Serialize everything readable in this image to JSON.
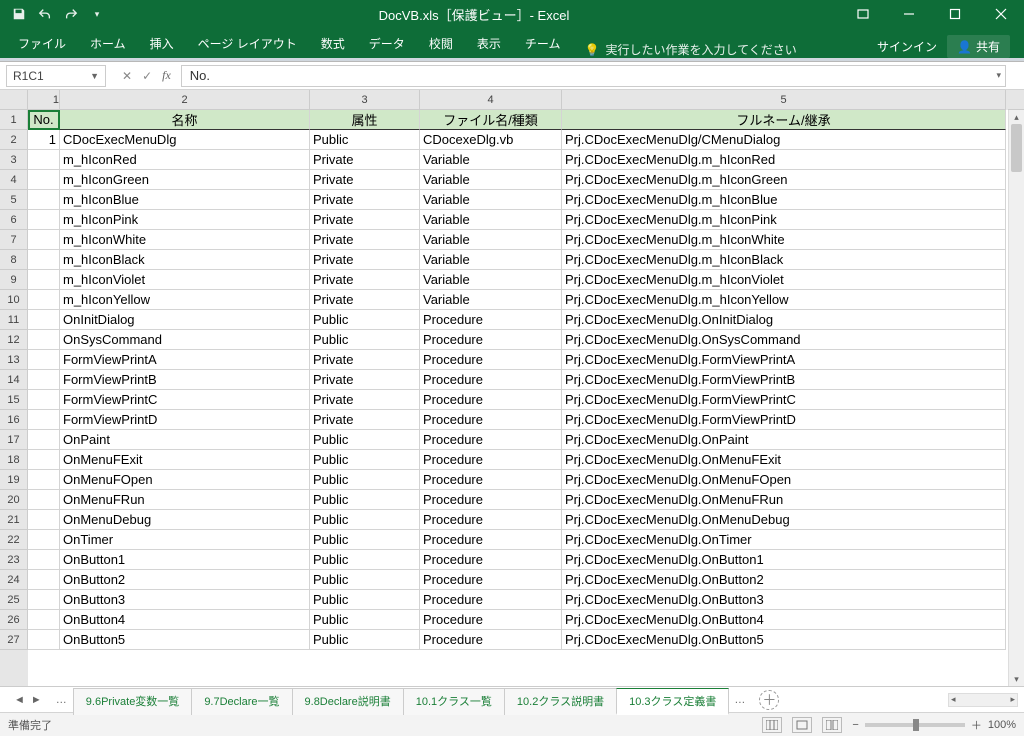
{
  "title": "DocVB.xls［保護ビュー］- Excel",
  "qat": {
    "save": "save-icon",
    "undo": "undo-icon",
    "redo": "redo-icon",
    "more": "▾"
  },
  "ribbon": {
    "tabs": [
      "ファイル",
      "ホーム",
      "挿入",
      "ページ レイアウト",
      "数式",
      "データ",
      "校閲",
      "表示",
      "チーム"
    ],
    "tellme": "実行したい作業を入力してください",
    "sign_in": "サインイン",
    "share": "共有"
  },
  "namebox": "R1C1",
  "formula": "No.",
  "columns": {
    "labels": [
      "1",
      "2",
      "3",
      "4",
      "5"
    ]
  },
  "headers": [
    "No.",
    "名称",
    "属性",
    "ファイル名/種類",
    "フルネーム/継承"
  ],
  "rows": [
    {
      "no": "1",
      "name": "CDocExecMenuDlg",
      "attr": "Public",
      "file": "CDocexeDlg.vb",
      "full": "Prj.CDocExecMenuDlg/CMenuDialog"
    },
    {
      "no": "",
      "name": "m_hIconRed",
      "attr": "Private",
      "file": "Variable",
      "full": "Prj.CDocExecMenuDlg.m_hIconRed"
    },
    {
      "no": "",
      "name": "m_hIconGreen",
      "attr": "Private",
      "file": "Variable",
      "full": "Prj.CDocExecMenuDlg.m_hIconGreen"
    },
    {
      "no": "",
      "name": "m_hIconBlue",
      "attr": "Private",
      "file": "Variable",
      "full": "Prj.CDocExecMenuDlg.m_hIconBlue"
    },
    {
      "no": "",
      "name": "m_hIconPink",
      "attr": "Private",
      "file": "Variable",
      "full": "Prj.CDocExecMenuDlg.m_hIconPink"
    },
    {
      "no": "",
      "name": "m_hIconWhite",
      "attr": "Private",
      "file": "Variable",
      "full": "Prj.CDocExecMenuDlg.m_hIconWhite"
    },
    {
      "no": "",
      "name": "m_hIconBlack",
      "attr": "Private",
      "file": "Variable",
      "full": "Prj.CDocExecMenuDlg.m_hIconBlack"
    },
    {
      "no": "",
      "name": "m_hIconViolet",
      "attr": "Private",
      "file": "Variable",
      "full": "Prj.CDocExecMenuDlg.m_hIconViolet"
    },
    {
      "no": "",
      "name": "m_hIconYellow",
      "attr": "Private",
      "file": "Variable",
      "full": "Prj.CDocExecMenuDlg.m_hIconYellow"
    },
    {
      "no": "",
      "name": "OnInitDialog",
      "attr": "Public",
      "file": "Procedure",
      "full": "Prj.CDocExecMenuDlg.OnInitDialog"
    },
    {
      "no": "",
      "name": "OnSysCommand",
      "attr": "Public",
      "file": "Procedure",
      "full": "Prj.CDocExecMenuDlg.OnSysCommand"
    },
    {
      "no": "",
      "name": "FormViewPrintA",
      "attr": "Private",
      "file": "Procedure",
      "full": "Prj.CDocExecMenuDlg.FormViewPrintA"
    },
    {
      "no": "",
      "name": "FormViewPrintB",
      "attr": "Private",
      "file": "Procedure",
      "full": "Prj.CDocExecMenuDlg.FormViewPrintB"
    },
    {
      "no": "",
      "name": "FormViewPrintC",
      "attr": "Private",
      "file": "Procedure",
      "full": "Prj.CDocExecMenuDlg.FormViewPrintC"
    },
    {
      "no": "",
      "name": "FormViewPrintD",
      "attr": "Private",
      "file": "Procedure",
      "full": "Prj.CDocExecMenuDlg.FormViewPrintD"
    },
    {
      "no": "",
      "name": "OnPaint",
      "attr": "Public",
      "file": "Procedure",
      "full": "Prj.CDocExecMenuDlg.OnPaint"
    },
    {
      "no": "",
      "name": "OnMenuFExit",
      "attr": "Public",
      "file": "Procedure",
      "full": "Prj.CDocExecMenuDlg.OnMenuFExit"
    },
    {
      "no": "",
      "name": "OnMenuFOpen",
      "attr": "Public",
      "file": "Procedure",
      "full": "Prj.CDocExecMenuDlg.OnMenuFOpen"
    },
    {
      "no": "",
      "name": "OnMenuFRun",
      "attr": "Public",
      "file": "Procedure",
      "full": "Prj.CDocExecMenuDlg.OnMenuFRun"
    },
    {
      "no": "",
      "name": "OnMenuDebug",
      "attr": "Public",
      "file": "Procedure",
      "full": "Prj.CDocExecMenuDlg.OnMenuDebug"
    },
    {
      "no": "",
      "name": "OnTimer",
      "attr": "Public",
      "file": "Procedure",
      "full": "Prj.CDocExecMenuDlg.OnTimer"
    },
    {
      "no": "",
      "name": "OnButton1",
      "attr": "Public",
      "file": "Procedure",
      "full": "Prj.CDocExecMenuDlg.OnButton1"
    },
    {
      "no": "",
      "name": "OnButton2",
      "attr": "Public",
      "file": "Procedure",
      "full": "Prj.CDocExecMenuDlg.OnButton2"
    },
    {
      "no": "",
      "name": "OnButton3",
      "attr": "Public",
      "file": "Procedure",
      "full": "Prj.CDocExecMenuDlg.OnButton3"
    },
    {
      "no": "",
      "name": "OnButton4",
      "attr": "Public",
      "file": "Procedure",
      "full": "Prj.CDocExecMenuDlg.OnButton4"
    },
    {
      "no": "",
      "name": "OnButton5",
      "attr": "Public",
      "file": "Procedure",
      "full": "Prj.CDocExecMenuDlg.OnButton5"
    }
  ],
  "sheets": {
    "ellipsis": "…",
    "tabs": [
      "9.6Private変数一覧",
      "9.7Declare一覧",
      "9.8Declare説明書",
      "10.1クラス一覧",
      "10.2クラス説明書",
      "10.3クラス定義書"
    ],
    "active_index": 5
  },
  "status": {
    "ready": "準備完了",
    "zoom": "100%"
  }
}
